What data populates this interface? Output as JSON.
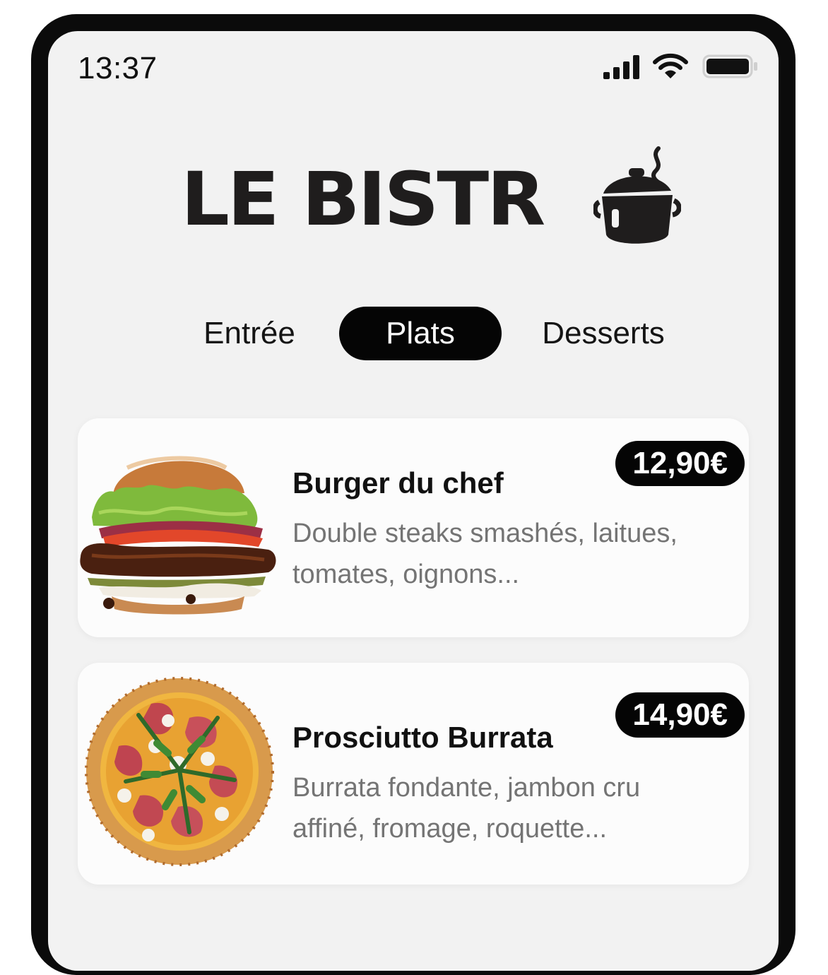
{
  "status_bar": {
    "time": "13:37",
    "icons": [
      "cellular-signal-icon",
      "wifi-icon",
      "battery-icon"
    ]
  },
  "header": {
    "logo_text": "LE BISTR",
    "logo_icon": "cooking-pot-icon"
  },
  "tabs": [
    {
      "label": "Entrée",
      "selected": false
    },
    {
      "label": "Plats",
      "selected": true
    },
    {
      "label": "Desserts",
      "selected": false
    }
  ],
  "dishes": [
    {
      "name": "Burger du chef",
      "description": "Double steaks smashés, laitues, tomates, oignons...",
      "price": "12,90€",
      "image": "burger-image"
    },
    {
      "name": "Prosciutto Burrata",
      "description": "Burrata fondante, jambon cru affiné, fromage, roquette...",
      "price": "14,90€",
      "image": "pizza-image"
    }
  ],
  "colors": {
    "background": "#f2f2f2",
    "frame": "#0b0b0b",
    "card": "#fcfcfc",
    "accent": "#050505",
    "description_text": "#747474"
  }
}
